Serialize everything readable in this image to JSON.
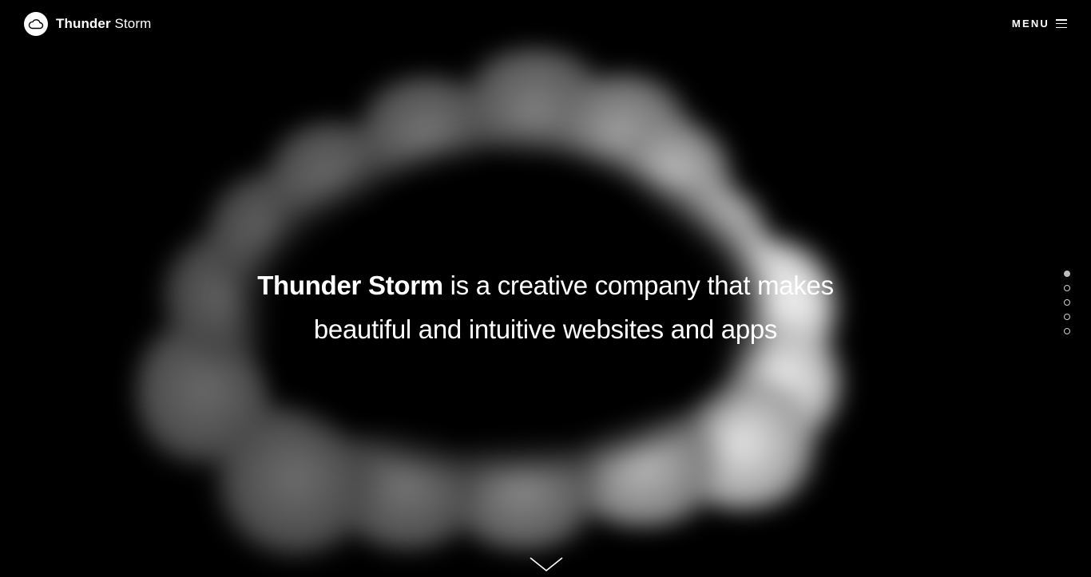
{
  "header": {
    "brand_bold": "Thunder",
    "brand_light": "Storm",
    "menu_label": "MENU",
    "logo_icon": "cloud-icon",
    "menu_icon": "hamburger-icon"
  },
  "hero": {
    "brand_name": "Thunder Storm",
    "line1_rest": "is a creative company that makes",
    "line2": "beautiful and intuitive websites and apps"
  },
  "pager": {
    "slides": [
      {
        "id": 1,
        "active": true
      },
      {
        "id": 2,
        "active": false
      },
      {
        "id": 3,
        "active": false
      },
      {
        "id": 4,
        "active": false
      },
      {
        "id": 5,
        "active": false
      }
    ]
  },
  "scroll_icon": "chevron-down-icon",
  "colors": {
    "background": "#000000",
    "text": "#ffffff",
    "cloud_dim": "#5a5a5a",
    "cloud_bright": "#f2f2f2"
  }
}
